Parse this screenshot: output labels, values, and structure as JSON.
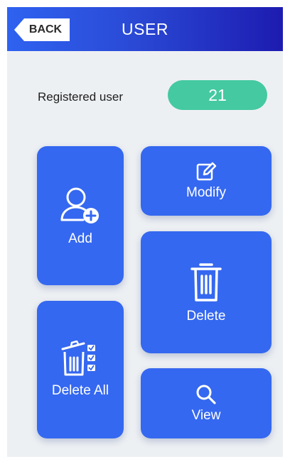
{
  "header": {
    "back_label": "BACK",
    "title": "USER"
  },
  "registered": {
    "label": "Registered user",
    "count": "21"
  },
  "actions": {
    "add": "Add",
    "modify": "Modify",
    "delete": "Delete",
    "delete_all": "Delete All",
    "view": "View"
  },
  "colors": {
    "accent": "#3568f0",
    "count_pill": "#45c9a0",
    "header_start": "#2f62f0",
    "header_end": "#1d1bb0"
  },
  "icons": {
    "add": "add-user-icon",
    "modify": "edit-icon",
    "delete": "trash-icon",
    "delete_all": "trash-checklist-icon",
    "view": "search-icon"
  }
}
